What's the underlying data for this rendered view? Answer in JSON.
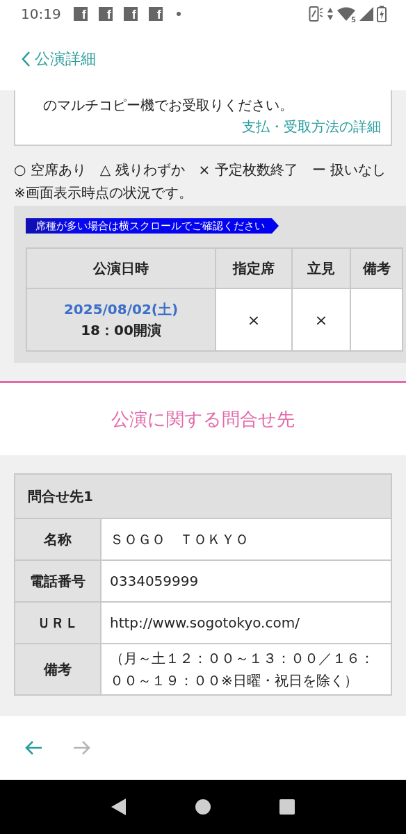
{
  "status_bar": {
    "time": "10:19",
    "notification_icons": [
      {
        "glyph": "f"
      },
      {
        "glyph": "f"
      },
      {
        "glyph": "f"
      },
      {
        "glyph": "f"
      }
    ],
    "wifi_badge": "5"
  },
  "header": {
    "back_label": "公演詳細"
  },
  "pickup_card": {
    "text": "のマルチコピー機でお受取りください。",
    "link": "支払・受取方法の詳細"
  },
  "legend": "○ 空席あり　△ 残りわずか　× 予定枚数終了　ー 扱いなし　※画面表示時点の状況です。",
  "scroll_hint": "席種が多い場合は横スクロールでご確認ください",
  "schedule_table": {
    "columns": [
      "公演日時",
      "指定席",
      "立見",
      "備考"
    ],
    "rows": [
      {
        "cells": [
          {
            "kind": "datetime",
            "date": "2025/08/02(土)",
            "time": "18：00開演"
          },
          {
            "kind": "mark",
            "text": "×"
          },
          {
            "kind": "mark",
            "text": "×"
          },
          {
            "kind": "empty"
          }
        ]
      }
    ]
  },
  "contact_section": {
    "title": "公演に関する問合せ先",
    "contacts": [
      {
        "heading": "問合せ先1",
        "fields": [
          {
            "label": "名称",
            "value": "ＳＯＧＯ　ＴＯＫＹＯ"
          },
          {
            "label": "電話番号",
            "value": "0334059999"
          },
          {
            "label": "ＵＲＬ",
            "value": "http://www.sogotokyo.com/"
          },
          {
            "label": "備考",
            "value": "（月～土１２：００～１３：００／１６：００～１９：００※日曜・祝日を除く）"
          }
        ]
      }
    ]
  },
  "nav_buttons": [
    {
      "kind": "back",
      "disabled": false
    },
    {
      "kind": "forward",
      "disabled": true
    }
  ]
}
